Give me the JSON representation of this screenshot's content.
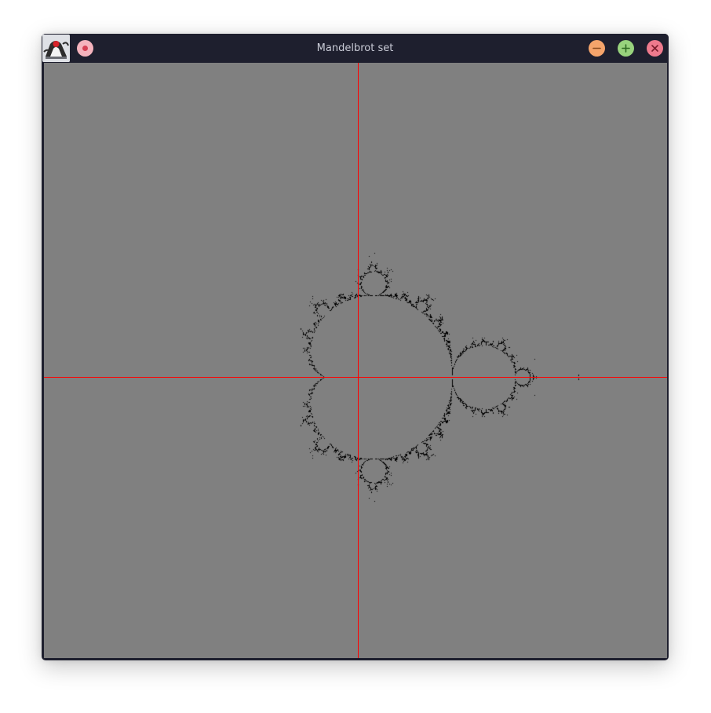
{
  "window": {
    "title": "Mandelbrot set"
  },
  "icons": {
    "app": "java-duke-icon",
    "pin": "pin-icon",
    "minimize": "minimize-icon",
    "maximize": "maximize-icon",
    "close": "close-icon"
  },
  "colors": {
    "titlebar": "#1e1f2e",
    "title_text": "#c9cbd6",
    "canvas_background": "#808080",
    "set_fill": "#000000",
    "axes": "#ff0000",
    "pin_button": "#f5b3bd",
    "minimize_button": "#f5a46b",
    "maximize_button": "#98d37d",
    "close_button": "#ef7a8d"
  }
}
